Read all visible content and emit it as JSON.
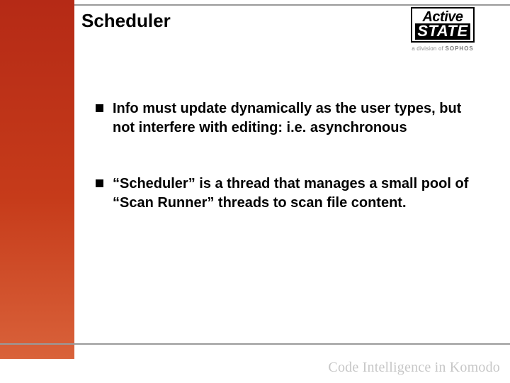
{
  "title": "Scheduler",
  "logo": {
    "line1": "Active",
    "line2": "STATE",
    "sub_prefix": "a division of ",
    "sub_brand": "SOPHOS"
  },
  "bullets": [
    "Info must update dynamically as the user types, but not interfere with editing: i.e. asynchronous",
    "“Scheduler” is a thread that manages a small pool of “Scan Runner” threads to scan file content."
  ],
  "footer": "Code Intelligence in Komodo"
}
